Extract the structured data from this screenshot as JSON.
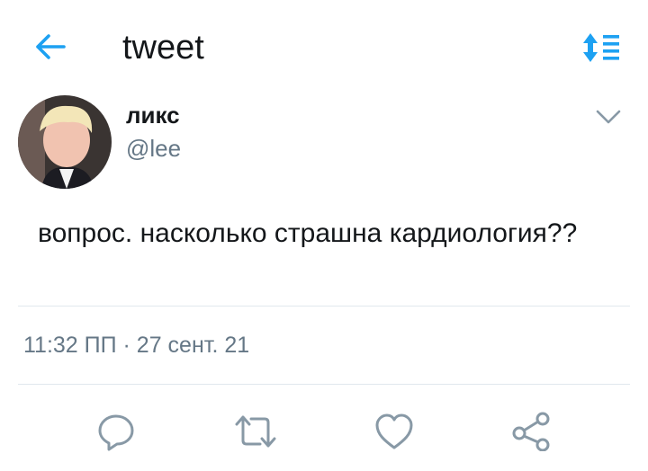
{
  "header": {
    "title": "tweet",
    "back_icon": "arrow-left-icon",
    "sort_icon": "sort-icon"
  },
  "tweet": {
    "display_name": "ликс",
    "handle": "@lee",
    "text": "вопрос. насколько страшна кардиология??",
    "timestamp": "11:32 ПП · 27 сент. 21",
    "menu_icon": "chevron-down-icon"
  },
  "actions": [
    {
      "icon": "reply-icon"
    },
    {
      "icon": "retweet-icon"
    },
    {
      "icon": "heart-icon"
    },
    {
      "icon": "share-icon"
    }
  ],
  "colors": {
    "accent": "#1da1f2",
    "text": "#14171a",
    "muted": "#657786",
    "icon": "#8899a6",
    "divider": "#e1e8ed"
  }
}
